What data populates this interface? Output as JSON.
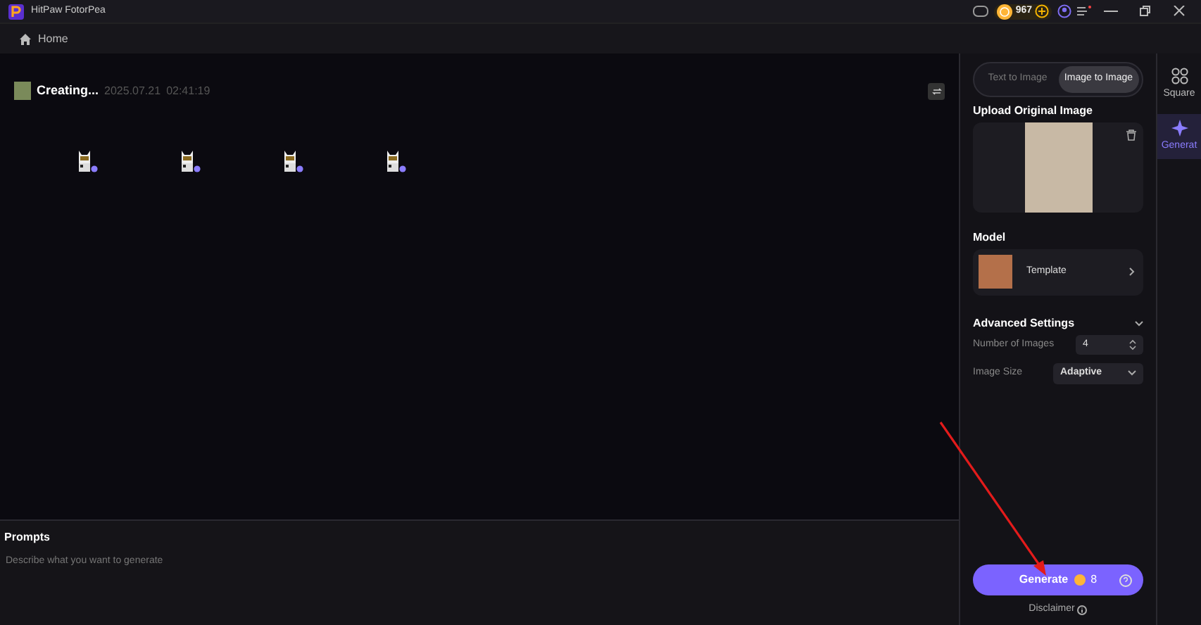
{
  "window": {
    "title": "HitPaw FotorPea",
    "credits": "967"
  },
  "nav": {
    "home": "Home"
  },
  "task": {
    "status": "Creating...",
    "date": "2025.07.21",
    "time": "02:41:19"
  },
  "mode_tabs": [
    {
      "label": "Text to Image",
      "selected": false
    },
    {
      "label": "Image to Image",
      "selected": true
    }
  ],
  "upload": {
    "title": "Upload Original Image"
  },
  "model": {
    "title": "Model",
    "name": "Template"
  },
  "advanced": {
    "title": "Advanced Settings",
    "expanded": true,
    "fields": [
      {
        "label": "Number of Images",
        "value": "4",
        "kind": "spinner"
      },
      {
        "label": "Image Size",
        "value": "Adaptive",
        "kind": "select"
      }
    ]
  },
  "prompts": {
    "title": "Prompts",
    "placeholder": "Describe what you want to generate"
  },
  "generate": {
    "label": "Generate",
    "cost": "8"
  },
  "disclaimer": "Disclaimer",
  "rail": [
    {
      "label": "Square",
      "selected": false
    },
    {
      "label": "Generat",
      "selected": true
    }
  ]
}
